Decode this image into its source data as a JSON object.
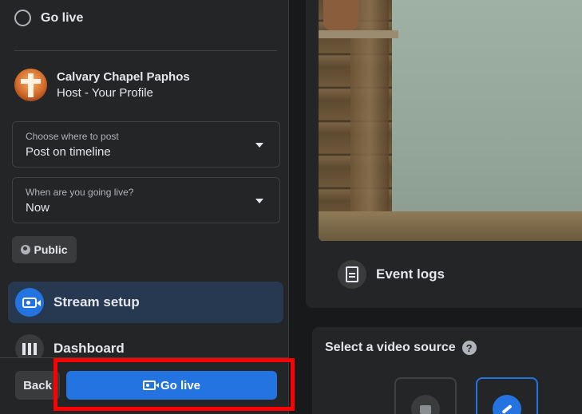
{
  "left_panel": {
    "radio_option": {
      "label": "Go live"
    },
    "profile": {
      "name": "Calvary Chapel Paphos",
      "role": "Host - Your Profile"
    },
    "post_location": {
      "label": "Choose where to post",
      "value": "Post on timeline"
    },
    "timing": {
      "label": "When are you going live?",
      "value": "Now"
    },
    "audience": {
      "label": "Public",
      "icon": "globe-icon"
    },
    "nav": [
      {
        "label": "Stream setup",
        "icon": "video-camera-icon",
        "active": true
      },
      {
        "label": "Dashboard",
        "icon": "dashboard-bars-icon",
        "active": false
      }
    ]
  },
  "footer": {
    "back_label": "Back",
    "go_live_label": "Go live",
    "highlight_color": "#ff0000"
  },
  "preview": {
    "event_logs_label": "Event logs"
  },
  "video_source": {
    "title": "Select a video source",
    "help_symbol": "?",
    "options": [
      {
        "icon": "camera-icon",
        "selected": false
      },
      {
        "icon": "streaming-key-icon",
        "selected": true
      }
    ]
  },
  "colors": {
    "accent": "#2374e1",
    "panel_bg": "#242526",
    "page_bg": "#18191a"
  }
}
